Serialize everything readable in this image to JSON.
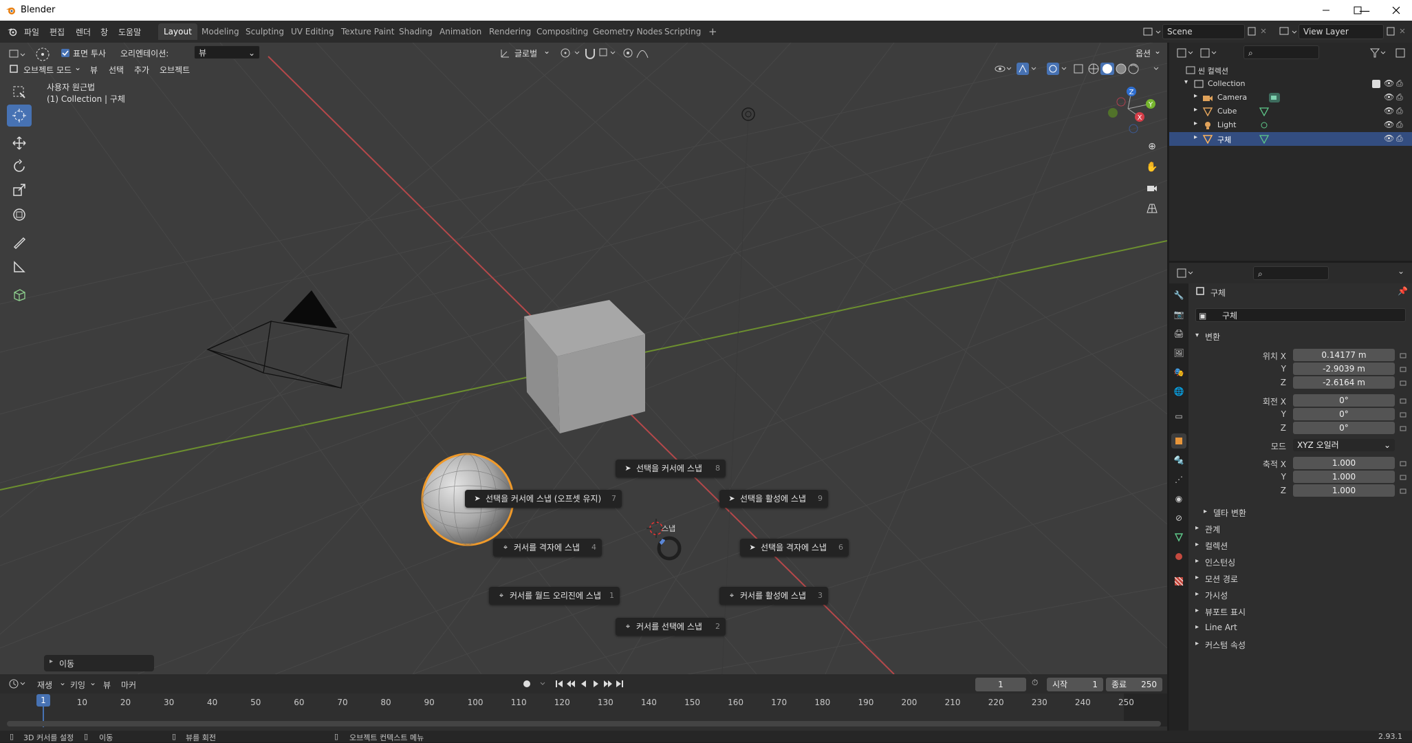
{
  "window": {
    "title": "Blender"
  },
  "menu": [
    "파일",
    "편집",
    "렌더",
    "창",
    "도움말"
  ],
  "workspaces": [
    "Layout",
    "Modeling",
    "Sculpting",
    "UV Editing",
    "Texture Paint",
    "Shading",
    "Animation",
    "Rendering",
    "Compositing",
    "Geometry Nodes",
    "Scripting",
    "+"
  ],
  "scene": {
    "name": "Scene",
    "view_layer": "View Layer"
  },
  "tool_header": {
    "surface_project": "표면 투사",
    "orientation_label": "오리엔테이션:",
    "orientation_value": "뷰",
    "transform_orientation": "글로벌",
    "options": "옵션"
  },
  "viewport_header": {
    "mode": "오브젝트 모드",
    "menus": [
      "뷰",
      "선택",
      "추가",
      "오브젝트"
    ]
  },
  "viewport_overlay": {
    "view_name": "사용자 원근법",
    "collection_info": "(1) Collection | 구체",
    "last_op": "이동",
    "snap_center_label": "스냅"
  },
  "snap_pie": [
    {
      "label": "선택을 커서에 스냅",
      "num": "8"
    },
    {
      "label": "선택을 커서에 스냅 (오프셋 유지)",
      "num": "7"
    },
    {
      "label": "선택을 활성에 스냅",
      "num": "9"
    },
    {
      "label": "커서를 격자에 스냅",
      "num": "4"
    },
    {
      "label": "선택을 격자에 스냅",
      "num": "6"
    },
    {
      "label": "커서를 월드 오리진에 스냅",
      "num": "1"
    },
    {
      "label": "커서를 활성에 스냅",
      "num": "3"
    },
    {
      "label": "커서를 선택에 스냅",
      "num": "2"
    }
  ],
  "outliner": {
    "root": "씬 컬렉션",
    "collection": "Collection",
    "objects": [
      {
        "name": "Camera",
        "selected": false
      },
      {
        "name": "Cube",
        "selected": false
      },
      {
        "name": "Light",
        "selected": false
      },
      {
        "name": "구체",
        "selected": true
      }
    ]
  },
  "properties": {
    "object_name": "구체",
    "object_field": "구체",
    "transform_title": "변환",
    "location_label": "위치 X",
    "location": [
      "0.14177 m",
      "-2.9039 m",
      "-2.6164 m"
    ],
    "rotation_label": "회전 X",
    "rotation": [
      "0°",
      "0°",
      "0°"
    ],
    "mode_label": "모드",
    "mode_value": "XYZ 오일러",
    "scale_label": "축적 X",
    "scale": [
      "1.000",
      "1.000",
      "1.000"
    ],
    "axis_y": "Y",
    "axis_z": "Z",
    "delta": "델타 변환",
    "panels": [
      "관계",
      "컬렉션",
      "인스턴싱",
      "모션 경로",
      "가시성",
      "뷰포트 표시",
      "Line Art",
      "커스텀 속성"
    ]
  },
  "timeline": {
    "menus": [
      "재생",
      "키잉",
      "뷰",
      "마커"
    ],
    "current_frame": "1",
    "start_label": "시작",
    "start": "1",
    "end_label": "종료",
    "end": "250",
    "ticks": [
      "10",
      "20",
      "30",
      "40",
      "50",
      "60",
      "70",
      "80",
      "90",
      "100",
      "110",
      "120",
      "130",
      "140",
      "150",
      "160",
      "170",
      "180",
      "190",
      "200",
      "210",
      "220",
      "230",
      "240",
      "250"
    ],
    "cursor_frame": "1"
  },
  "statusbar": {
    "items": [
      "3D 커서를 설정",
      "이동",
      "뷰를 회전",
      "오브젝트 컨텍스트 메뉴"
    ],
    "version": "2.93.1"
  }
}
